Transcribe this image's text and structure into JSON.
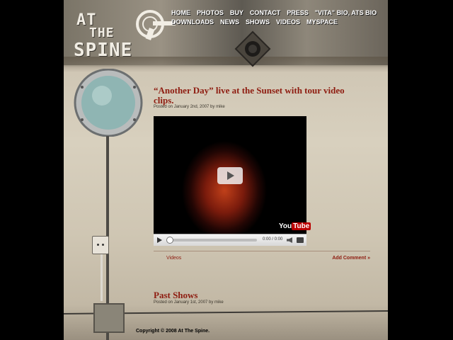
{
  "logo": {
    "line1": "AT",
    "line2": "THE",
    "line3": "SPINE",
    "emblem_icon": "sonic-revolver-emblem-icon"
  },
  "nav": {
    "row1": [
      "HOME",
      "PHOTOS",
      "BUY",
      "CONTACT",
      "PRESS",
      "\"VITA\" BIO, ATS BIO"
    ],
    "row2": [
      "DOWNLOADS",
      "NEWS",
      "SHOWS",
      "VIDEOS",
      "MYSPACE"
    ]
  },
  "posts": [
    {
      "title": "“Another Day” live at the Sunset with tour video clips.",
      "meta": "Posted on January 2nd, 2007 by mike",
      "video": {
        "time": "0:00 / 0:00",
        "brand": "YouTube",
        "brand_you": "You",
        "brand_tube": "Tube"
      },
      "category": "Videos",
      "comment_link": "Add Comment »"
    },
    {
      "title": "Past Shows",
      "meta": "Posted on January 1st, 2007 by mike"
    }
  ],
  "footer": {
    "copyright": "Copyright © 2008 At The Spine."
  },
  "colors": {
    "accent": "#8e1c10",
    "nav_text": "#ffffff",
    "background": "#000000"
  }
}
